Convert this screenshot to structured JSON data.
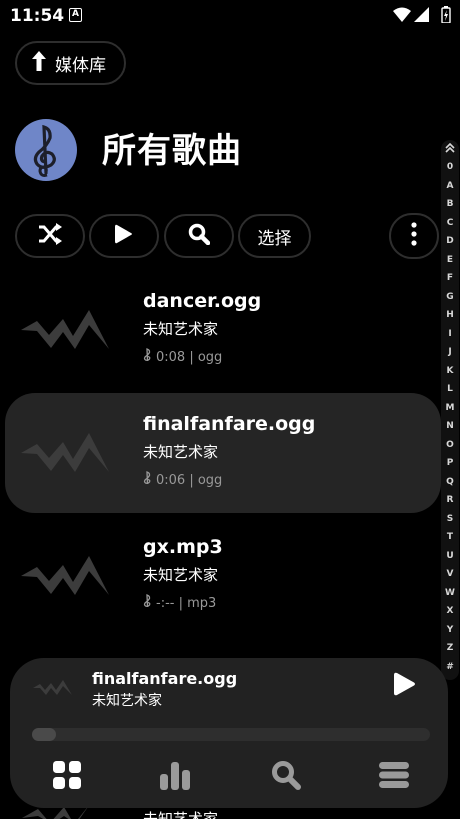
{
  "status": {
    "time": "11:54",
    "notif_badge": "A"
  },
  "header": {
    "back_label": "媒体库",
    "title": "所有歌曲"
  },
  "actions": {
    "select_label": "选择"
  },
  "az_index": [
    "0",
    "A",
    "B",
    "C",
    "D",
    "E",
    "F",
    "G",
    "H",
    "I",
    "J",
    "K",
    "L",
    "M",
    "N",
    "O",
    "P",
    "Q",
    "R",
    "S",
    "T",
    "U",
    "V",
    "W",
    "X",
    "Y",
    "Z",
    "#"
  ],
  "songs": [
    {
      "title": "dancer.ogg",
      "artist": "未知艺术家",
      "meta": "0:08 | ogg"
    },
    {
      "title": "finalfanfare.ogg",
      "artist": "未知艺术家",
      "meta": "0:06 | ogg"
    },
    {
      "title": "gx.mp3",
      "artist": "未知艺术家",
      "meta": "-:-- | mp3"
    }
  ],
  "partial_song": {
    "artist": "未知艺术家"
  },
  "now_playing": {
    "title": "finalfanfare.ogg",
    "artist": "未知艺术家",
    "progress": 0.06
  },
  "bottom_nav": [
    "grid-icon",
    "bar-chart-icon",
    "search-icon",
    "menu-icon"
  ],
  "colors": {
    "background": "#000000",
    "accent": "#6f86c8",
    "selected_row": "#252525",
    "mini_player": "#222222"
  }
}
